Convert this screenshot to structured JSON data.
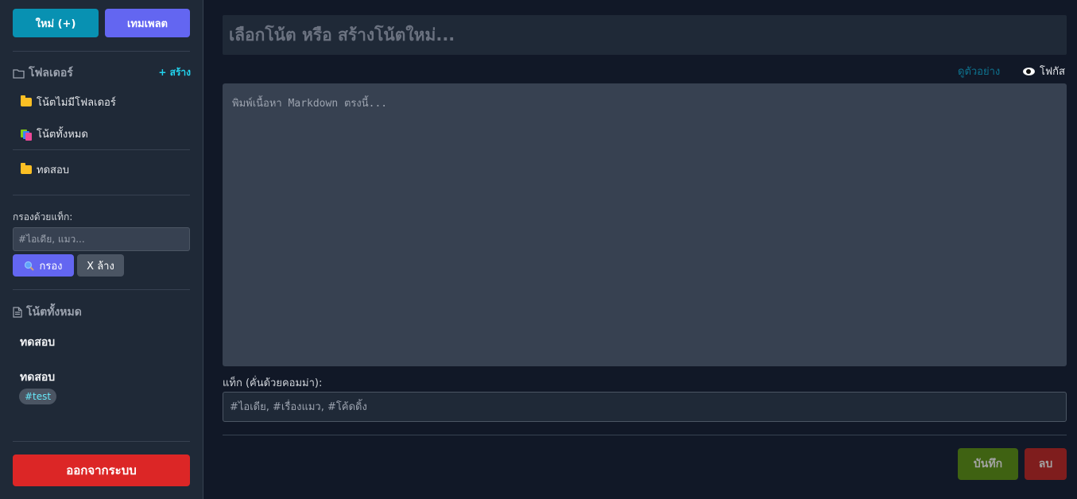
{
  "sidebar": {
    "new_button": "ใหม่ (+)",
    "template_button": "เทมเพลต",
    "folders_title": "โฟลเดอร์",
    "create_link": "+ สร้าง",
    "folders": [
      {
        "label": "โน้ตไม่มีโฟลเดอร์",
        "icon": "open-folder-icon"
      },
      {
        "label": "โน้ตทั้งหมด",
        "icon": "stacked-notes-icon"
      },
      {
        "label": "ทดสอบ",
        "icon": "folder-icon"
      }
    ],
    "filter_label": "กรองด้วยแท็ก:",
    "filter_placeholder": "#ไอเดีย, แมว...",
    "filter_button": "กรอง",
    "clear_button": "X ล้าง",
    "notes_title": "โน้ตทั้งหมด",
    "notes": [
      {
        "title": "ทดสอบ"
      },
      {
        "title": "ทดสอบ",
        "tag": "#test"
      }
    ],
    "logout_button": "ออกจากระบบ"
  },
  "main": {
    "title_placeholder": "เลือกโน้ต หรือ สร้างโน้ตใหม่...",
    "preview_link": "ดูตัวอย่าง",
    "focus_button": "โฟกัส",
    "content_placeholder": "พิมพ์เนื้อหา Markdown ตรงนี้...",
    "tags_label": "แท็ก (คั่นด้วยคอมม่า):",
    "tags_placeholder": "#ไอเดีย, #เรื่องแมว, #โค้ดดิ้ง",
    "save_button": "บันทึก",
    "delete_button": "ลบ"
  },
  "colors": {
    "background": "#111827",
    "sidebar": "#1f2937",
    "accent_cyan": "#0891b2",
    "accent_indigo": "#6366f1",
    "danger": "#dc2626"
  }
}
